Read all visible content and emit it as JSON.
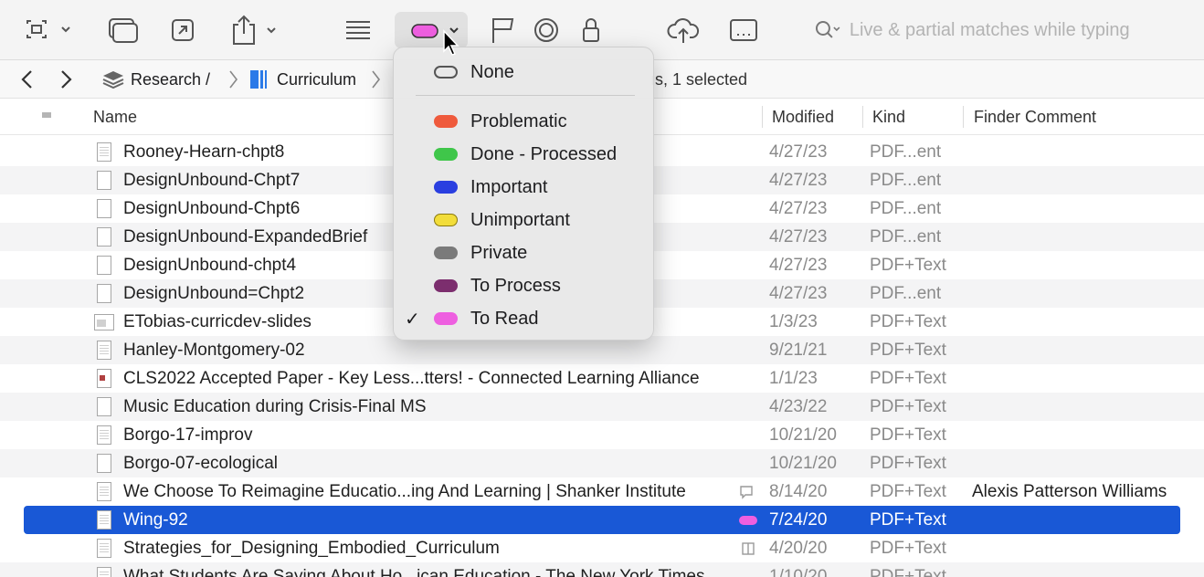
{
  "toolbar": {
    "buttons": [
      {
        "icon": "capture-icon"
      },
      {
        "icon": "windows-icon"
      },
      {
        "icon": "open-external-icon"
      },
      {
        "icon": "share-icon"
      },
      {
        "icon": "list-view-icon"
      },
      {
        "icon": "label-icon"
      },
      {
        "icon": "flag-icon"
      },
      {
        "icon": "target-icon"
      },
      {
        "icon": "lock-icon"
      },
      {
        "icon": "cloud-upload-icon"
      },
      {
        "icon": "inspector-icon"
      }
    ],
    "search_placeholder": "Live & partial matches while typing"
  },
  "pathbar": {
    "crumbs": [
      "Research /",
      "Curriculum"
    ],
    "status": "ıs, 1 selected"
  },
  "table": {
    "headers": {
      "name": "Name",
      "modified": "Modified",
      "kind": "Kind",
      "comment": "Finder Comment"
    },
    "rows": [
      {
        "name": "Rooney-Hearn-chpt8",
        "modified": "4/27/23",
        "kind": "PDF...ent",
        "comment": "",
        "icon": "thumb"
      },
      {
        "name": "DesignUnbound-Chpt7",
        "modified": "4/27/23",
        "kind": "PDF...ent",
        "comment": "",
        "icon": "doc"
      },
      {
        "name": "DesignUnbound-Chpt6",
        "modified": "4/27/23",
        "kind": "PDF...ent",
        "comment": "",
        "icon": "doc"
      },
      {
        "name": "DesignUnbound-ExpandedBrief",
        "modified": "4/27/23",
        "kind": "PDF...ent",
        "comment": "",
        "icon": "doc"
      },
      {
        "name": "DesignUnbound-chpt4",
        "modified": "4/27/23",
        "kind": "PDF+Text",
        "comment": "",
        "icon": "doc"
      },
      {
        "name": "DesignUnbound=Chpt2",
        "modified": "4/27/23",
        "kind": "PDF...ent",
        "comment": "",
        "icon": "doc"
      },
      {
        "name": "ETobias-curricdev-slides",
        "modified": "1/3/23",
        "kind": "PDF+Text",
        "comment": "",
        "icon": "img"
      },
      {
        "name": "Hanley-Montgomery-02",
        "modified": "9/21/21",
        "kind": "PDF+Text",
        "comment": "",
        "icon": "thumb"
      },
      {
        "name": "CLS2022 Accepted Paper - Key Less...tters! - Connected Learning Alliance",
        "modified": "1/1/23",
        "kind": "PDF+Text",
        "comment": "",
        "icon": "red"
      },
      {
        "name": "Music Education during Crisis-Final MS",
        "modified": "4/23/22",
        "kind": "PDF+Text",
        "comment": "",
        "icon": "doc"
      },
      {
        "name": "Borgo-17-improv",
        "modified": "10/21/20",
        "kind": "PDF+Text",
        "comment": "",
        "icon": "thumb"
      },
      {
        "name": "Borgo-07-ecological",
        "modified": "10/21/20",
        "kind": "PDF+Text",
        "comment": "",
        "icon": "doc"
      },
      {
        "name": "We Choose To Reimagine Educatio...ing And Learning | Shanker Institute",
        "modified": "8/14/20",
        "kind": "PDF+Text",
        "comment": "Alexis Patterson Williams",
        "icon": "thumb",
        "badge": "comment-icon"
      },
      {
        "name": "Wing-92",
        "modified": "7/24/20",
        "kind": "PDF+Text",
        "comment": "",
        "icon": "thumb",
        "selected": true,
        "label_color": "#ee5fe0"
      },
      {
        "name": "Strategies_for_Designing_Embodied_Curriculum",
        "modified": "4/20/20",
        "kind": "PDF+Text",
        "comment": "",
        "icon": "thumb",
        "badge": "book-icon"
      },
      {
        "name": "What Students Are Saying About Ho...ican Education - The New York Times",
        "modified": "1/10/20",
        "kind": "PDF+Text",
        "comment": "",
        "icon": "thumb"
      }
    ]
  },
  "label_menu": {
    "items": [
      {
        "label": "None",
        "color": "none",
        "checked": false
      },
      {
        "label": "Problematic",
        "color": "#ef5a3c",
        "checked": false
      },
      {
        "label": "Done - Processed",
        "color": "#3fc64a",
        "checked": false
      },
      {
        "label": "Important",
        "color": "#2a3fe0",
        "checked": false
      },
      {
        "label": "Unimportant",
        "color": "#f2dd3a",
        "checked": false
      },
      {
        "label": "Private",
        "color": "#7a7a7a",
        "checked": false
      },
      {
        "label": "To Process",
        "color": "#7c2e6e",
        "checked": false
      },
      {
        "label": "To Read",
        "color": "#ee5fe0",
        "checked": true
      }
    ],
    "checkmark": "✓"
  },
  "colors": {
    "selection": "#1958d6",
    "active_label": "#ee5fe0"
  }
}
